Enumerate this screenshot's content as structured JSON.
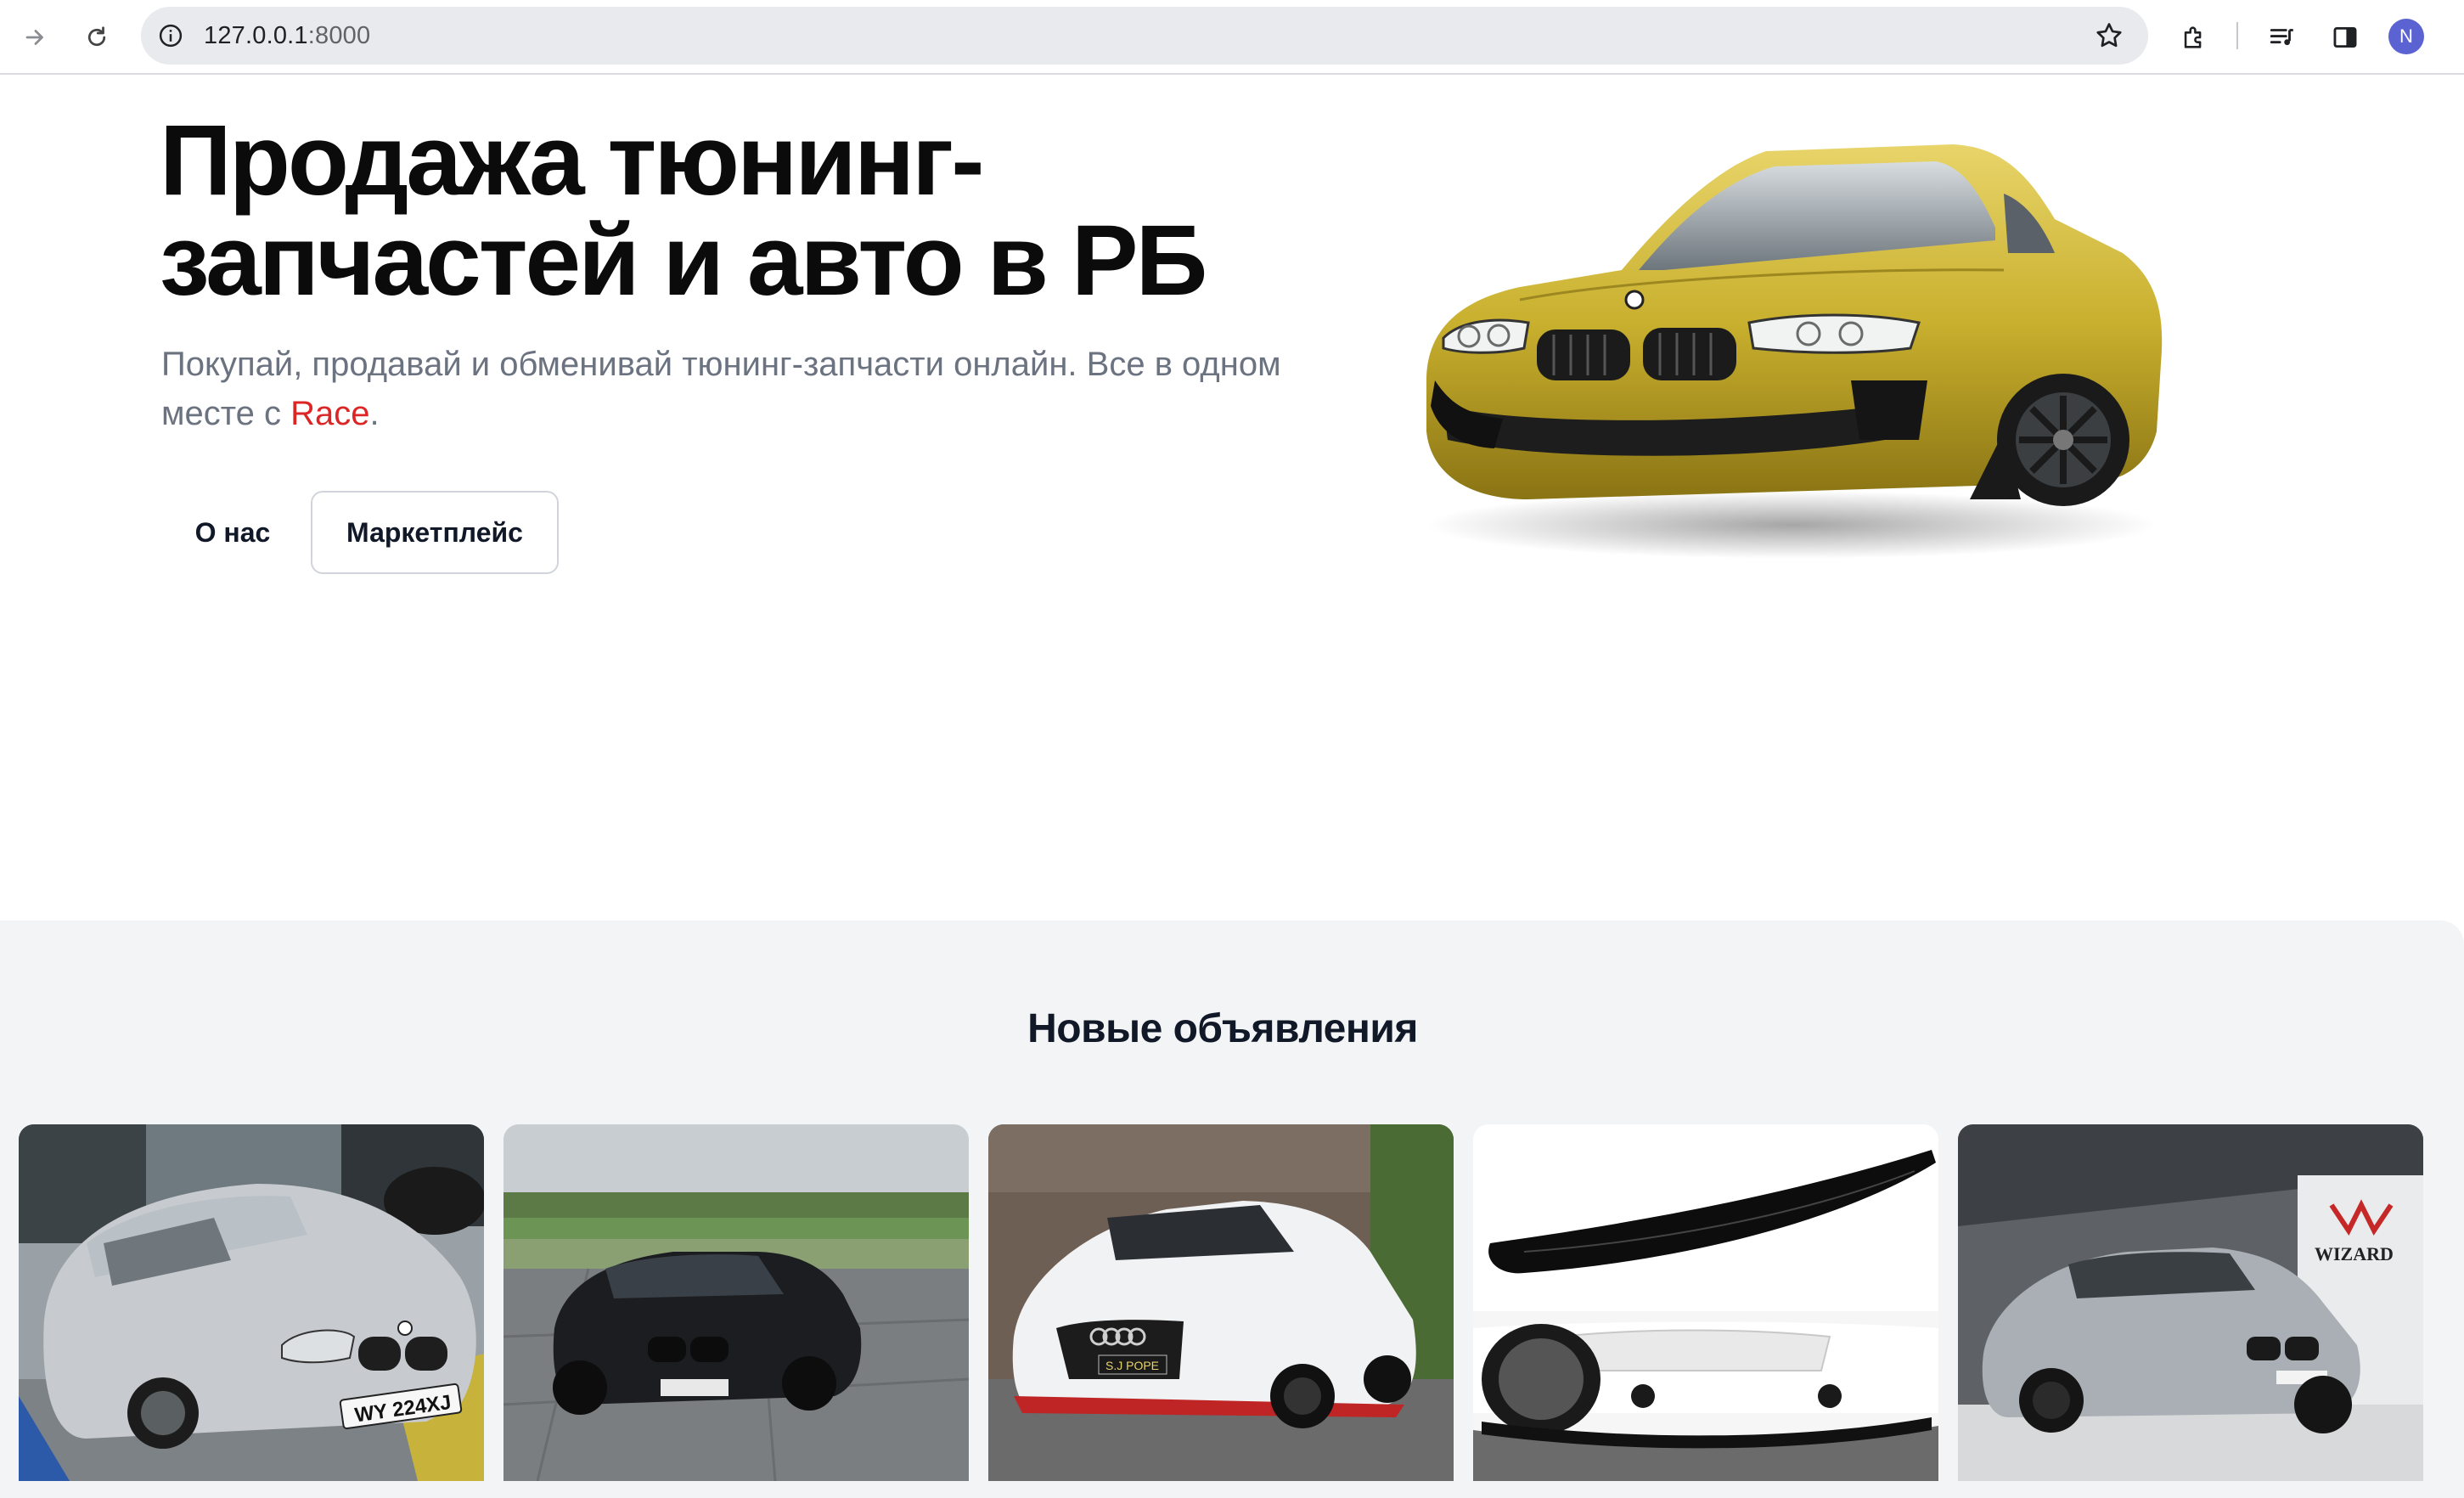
{
  "browser": {
    "url_host": "127.0.0.1",
    "url_port": ":8000",
    "profile_initial": "N"
  },
  "hero": {
    "title_line1": "Продажа тюнинг-",
    "title_line2": "запчастей и авто в РБ",
    "subtitle_text": "Покупай, продавай и обменивай тюнинг-запчасти онлайн. Все в одном месте с ",
    "brand": "Race",
    "subtitle_end": ".",
    "about_button": "О нас",
    "marketplace_button": "Маркетплейс"
  },
  "listings": {
    "title": "Новые объявления",
    "cards": [
      {
        "name": "silver-convertible",
        "plate": "WY 224XJ"
      },
      {
        "name": "black-sedan"
      },
      {
        "name": "white-hatchback",
        "plate": "S.J POPE"
      },
      {
        "name": "front-lip-part"
      },
      {
        "name": "silver-coupe",
        "sign": "WIZARD"
      }
    ]
  },
  "colors": {
    "brand": "#dc2626",
    "section_bg": "#f3f4f6",
    "avatar": "#5b63d3"
  }
}
